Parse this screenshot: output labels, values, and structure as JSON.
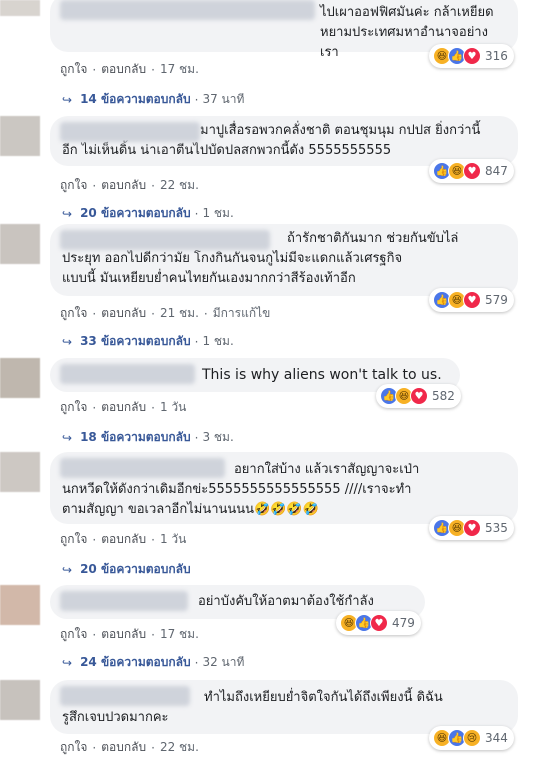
{
  "labels": {
    "like": "ถูกใจ",
    "reply": "ตอบกลับ",
    "dot": "·",
    "edited": "มีการแก้ไข"
  },
  "comments": [
    {
      "text": "ไปเผาออฟฟิศมันค่ะ กล้าเหยียด\nหยามประเทศมหาอำนาจอย่างเรา",
      "reaction_count": "316",
      "time": "17 ชม.",
      "replies": "14 ข้อความตอบกลับ",
      "replies_time": "37 นาที"
    },
    {
      "text": "มาปูเสื่อรอพวกคลั่งชาติ ตอนชุมนุม กปปส ยิ่งกว่านี้\nอีก ไม่เห็นดิ้น น่าเอาตีนไปบัดปลสกพวกนี้ดัง 5555555555",
      "reaction_count": "847",
      "time": "22 ชม.",
      "replies": "20 ข้อความตอบกลับ",
      "replies_time": "1 ชม."
    },
    {
      "text": "ถ้ารักชาติกันมาก ช่วยกันขับไล่\nประยุท ออกไปดีกว่ามัย โกงกินกันจนกูไม่มีจะแดกแล้วเศรฐกิจ\nแบบนี้ มันเหยียบย่ำคนไทยกันเองมากกว่าสีร้องเท้าอีก",
      "reaction_count": "579",
      "time": "21 ชม.",
      "edited": true,
      "replies": "33 ข้อความตอบกลับ",
      "replies_time": "1 ชม."
    },
    {
      "text": "This is why aliens won't talk to us.",
      "reaction_count": "582",
      "time": "1 วัน",
      "replies": "18 ข้อความตอบกลับ",
      "replies_time": "3 ชม."
    },
    {
      "text": "อยากใส่บ้าง แล้วเราสัญญาจะเป่า\nนกหวีดให้ดังกว่าเดิมอีกข่ะ5555555555555555 ////เราจะทำ\nตามสัญญา ขอเวลาอีกไม่นานนนน🤣🤣🤣🤣",
      "reaction_count": "535",
      "time": "1 วัน",
      "replies": "20 ข้อความตอบกลับ",
      "replies_time": ""
    },
    {
      "text": "อย่าบังคับให้อาตมาต้องใช้กำลัง",
      "reaction_count": "479",
      "time": "17 ชม.",
      "replies": "24 ข้อความตอบกลับ",
      "replies_time": "32 นาที"
    },
    {
      "text": "ทำไมถึงเหยียบย่ำจิตใจกันได้ถึงเพียงนี้ ดิฉัน\nรูสึกเจบปวดมากคะ",
      "reaction_count": "344",
      "time": "22 ชม.",
      "replies": "",
      "replies_time": ""
    }
  ]
}
